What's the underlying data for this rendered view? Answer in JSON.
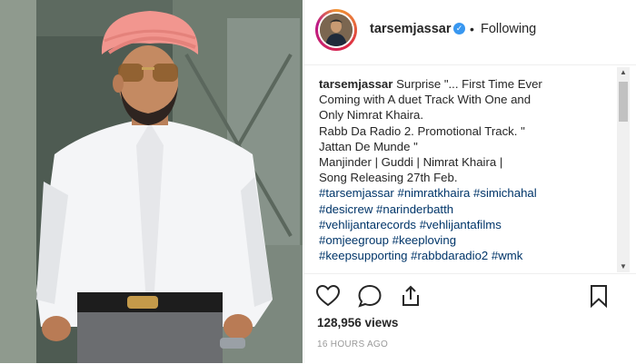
{
  "post": {
    "username": "tarsemjassar",
    "separator": "•",
    "follow_label": "Following",
    "caption": {
      "username": "tarsemjassar",
      "lines": [
        "Surprise \"... First Time Ever",
        "Coming with A duet Track With One and",
        "Only Nimrat Khaira.",
        "Rabb Da Radio 2. Promotional Track. \"",
        "Jattan De Munde \"",
        "Manjinder | Guddi | Nimrat Khaira |",
        "Song Releasing 27th Feb."
      ],
      "hashtag_lines": [
        "#tarsemjassar #nimratkhaira #simichahal",
        "#desicrew #narinderbatth",
        "#vehlijantarecords #vehlijantafilms",
        "#omjeegroup #keeploving",
        "#keepsupporting #rabbdaradio2 #wmk"
      ]
    },
    "views": "128,956 views",
    "timestamp": "16 HOURS AGO"
  },
  "icons": {
    "verified": "verified-badge-icon",
    "like": "heart-icon",
    "comment": "comment-bubble-icon",
    "share": "share-icon",
    "save": "bookmark-icon"
  },
  "colors": {
    "accent": "#3897f0",
    "text": "#262626",
    "hashtag": "#003569",
    "muted": "#999999"
  }
}
